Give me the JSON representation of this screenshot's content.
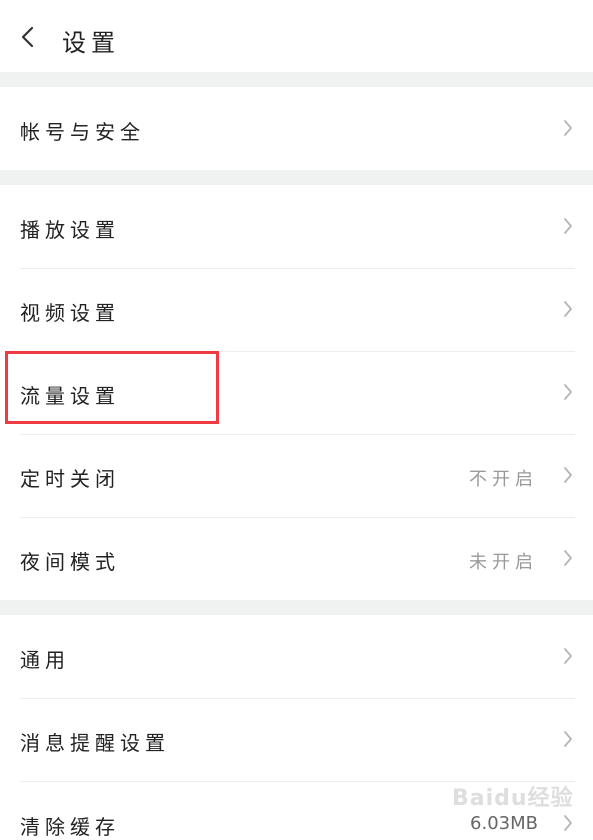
{
  "header": {
    "title": "设置",
    "back_icon": "chevron-left-icon"
  },
  "groups": [
    {
      "items": [
        {
          "label": "帐号与安全",
          "value": ""
        }
      ]
    },
    {
      "items": [
        {
          "label": "播放设置",
          "value": ""
        },
        {
          "label": "视频设置",
          "value": ""
        },
        {
          "label": "流量设置",
          "value": ""
        },
        {
          "label": "定时关闭",
          "value": "不开启"
        },
        {
          "label": "夜间模式",
          "value": "未开启"
        }
      ]
    },
    {
      "items": [
        {
          "label": "通用",
          "value": ""
        },
        {
          "label": "消息提醒设置",
          "value": ""
        },
        {
          "label": "清除缓存",
          "value": "6.03MB"
        }
      ]
    }
  ],
  "watermark": "Baidu经验",
  "colors": {
    "highlight": "#ee3a42",
    "separator": "#eff2f1",
    "value_text": "#9a9a9a"
  }
}
